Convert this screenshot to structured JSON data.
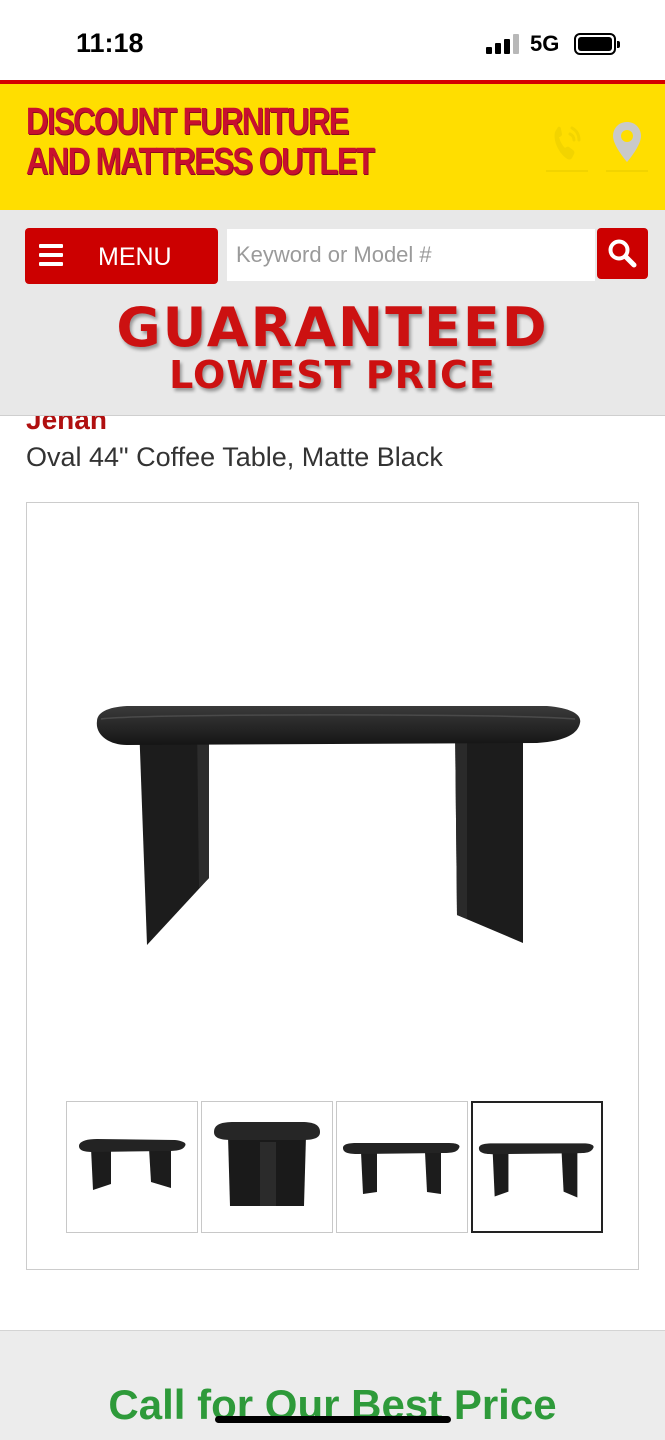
{
  "status_bar": {
    "time": "11:18",
    "network": "5G"
  },
  "header": {
    "logo_line1": "DISCOUNT FURNITURE",
    "logo_line2": "AND MATTRESS OUTLET",
    "icons": [
      "phone-icon",
      "map-pin-icon"
    ],
    "colors": {
      "background": "#ffde00",
      "logo": "#c8102e",
      "accent_line": "#d40000"
    }
  },
  "nav": {
    "menu_label": "MENU",
    "search_placeholder": "Keyword or Model #",
    "search_value": ""
  },
  "promo": {
    "line1": "GUARANTEED",
    "line2": "LOWEST PRICE"
  },
  "product": {
    "brand": "Jenan",
    "title": "Oval 44\" Coffee Table, Matte Black"
  },
  "gallery": {
    "thumbnail_count": 4,
    "selected_thumbnail_index": 3
  },
  "cta": {
    "text": "Call for Our Best Price",
    "color": "#2e9a3a"
  }
}
